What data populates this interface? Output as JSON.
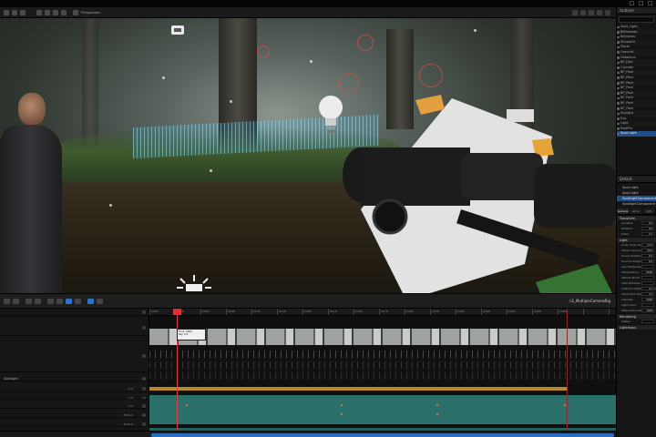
{
  "titlebar": {
    "window_buttons": [
      "minimize",
      "maximize",
      "close"
    ]
  },
  "viewport_toolbar": {
    "perspective_label": "Perspective",
    "icons": [
      "select-icon",
      "move-icon",
      "grid-icon",
      "camera-icon",
      "lit-icon"
    ]
  },
  "viewport": {
    "stats_text": "",
    "selected_actor": "Spot Light"
  },
  "outliner": {
    "title": "Outliner",
    "items": [
      "Spot_Light_",
      "BillboardsL",
      "Backgrou",
      "SimpleFo",
      "Decal",
      "GroundL",
      "Detaileva",
      "BP_Fold",
      "Cylinder",
      "BP_Pack",
      "BP_Pack",
      "BP_Pack",
      "BP_Pack",
      "BP_Pack",
      "BP_Pack",
      "BP_Pack",
      "BP_Pack",
      "Skylight",
      "Exp",
      "Light",
      "PostPro",
      "Spot Light"
    ],
    "selected_index": 21
  },
  "details": {
    "title": "Details",
    "actor_name": "Spot Light",
    "components": [
      "Spot Light",
      "SpotLightComponent",
      "SpotlightComponent"
    ],
    "tabs": [
      "General",
      "Actor",
      "LOD"
    ],
    "sections": [
      {
        "name": "Transform",
        "props": [
          [
            "Location",
            "0.0"
          ],
          [
            "Rotation",
            "0.0"
          ],
          [
            "Scale",
            "1.0"
          ]
        ]
      },
      {
        "name": "Light",
        "props": [
          [
            "Inner Cone Angle",
            "17.8"
          ],
          [
            "Outer Cone Angle",
            "44.0"
          ],
          [
            "Source Radius",
            "0.0"
          ],
          [
            "Source Length",
            "0.0"
          ],
          [
            "Use Temperature",
            ""
          ],
          [
            "Temperature",
            "6500"
          ],
          [
            "Affects World",
            ""
          ],
          [
            "Cast Shadows",
            ""
          ],
          [
            "Indirect Lighting Intensity",
            "1.0"
          ],
          [
            "Volumetric Scattering",
            "1.0"
          ],
          [
            "Intensity",
            "5000"
          ],
          [
            "Light Color",
            ""
          ],
          [
            "Attenuation Radius",
            "1000"
          ]
        ]
      },
      {
        "name": "Rendering",
        "props": [
          [
            "Visible",
            ""
          ]
        ]
      },
      {
        "name": "Lightmass",
        "props": []
      }
    ]
  },
  "sequencer": {
    "sequence_name": "LS_MultipleCameraRig",
    "tracks": [
      {
        "label": "",
        "value": ""
      },
      {
        "label": "",
        "value": ""
      },
      {
        "label": "",
        "value": ""
      },
      {
        "label": "Spotlight",
        "value": ""
      },
      {
        "label": "",
        "value": "0.0"
      },
      {
        "label": "",
        "value": "0.0"
      },
      {
        "label": "",
        "value": "0.0"
      },
      {
        "label": "",
        "value": "3500.0"
      },
      {
        "label": "",
        "value": "5000.0"
      },
      {
        "label": "",
        "value": ""
      },
      {
        "label": "",
        "value": ""
      }
    ],
    "tooltip_lines": [
      "Time: 0000",
      "Key: 0.0"
    ],
    "ruler_labels": [
      "0000",
      "0030",
      "0060",
      "0090",
      "0120",
      "0150",
      "0180",
      "0210",
      "0240",
      "0270",
      "0300",
      "0330",
      "0360",
      "0390",
      "0420",
      "0450",
      "0480"
    ]
  },
  "colors": {
    "selection": "#1f4f86",
    "playhead": "#e04040",
    "orange_track": "#b8892a",
    "teal_track": "#2b6f6a",
    "toolbar_active": "#2e73c7"
  }
}
